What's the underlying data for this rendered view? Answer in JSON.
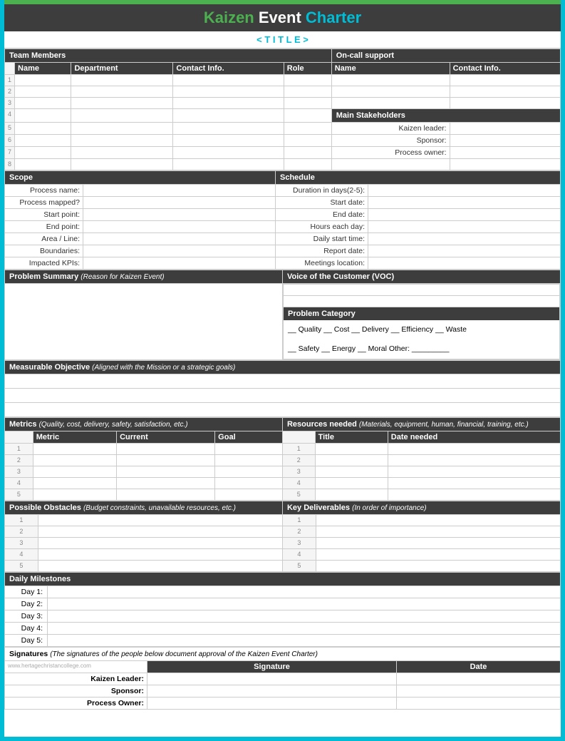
{
  "header": {
    "kaizen": "Kaizen",
    "event": " Event ",
    "charter": "Charter",
    "subtitle": "< T I T L E >",
    "website": "www.hertagechristancollege.com"
  },
  "team_members": {
    "label": "Team Members",
    "columns": [
      "Name",
      "Department",
      "Contact Info.",
      "Role"
    ],
    "rows": [
      "1",
      "2",
      "3",
      "4",
      "5",
      "6",
      "7",
      "8"
    ]
  },
  "on_call_support": {
    "label": "On-call support",
    "columns": [
      "Name",
      "Contact Info."
    ],
    "rows": [
      "",
      "",
      "",
      ""
    ]
  },
  "main_stakeholders": {
    "label": "Main Stakeholders",
    "rows": [
      "Kaizen leader:",
      "Sponsor:",
      "Process owner:"
    ]
  },
  "scope": {
    "label": "Scope",
    "rows": [
      "Process name:",
      "Process mapped?",
      "Start point:",
      "End point:",
      "Area / Line:",
      "Boundaries:",
      "Impacted KPIs:"
    ]
  },
  "schedule": {
    "label": "Schedule",
    "rows": [
      "Duration in days(2-5):",
      "Start date:",
      "End date:",
      "Hours each day:",
      "Daily start time:",
      "Report date:",
      "Meetings location:"
    ]
  },
  "problem_summary": {
    "label": "Problem Summary",
    "note": "(Reason for Kaizen Event)"
  },
  "voc": {
    "label": "Voice of the Customer (VOC)"
  },
  "problem_category": {
    "label": "Problem Category",
    "row1": "__ Quality   __ Cost   __ Delivery   __ Efficiency   __ Waste",
    "row2": "__ Safety   __ Energy   __ Moral   Other: _________"
  },
  "measurable_objective": {
    "label": "Measurable Objective",
    "note": "(Aligned with the Mission or a strategic goals)"
  },
  "metrics": {
    "label": "Metrics",
    "note": "(Quality, cost, delivery, safety, satisfaction, etc.)",
    "columns": [
      "Metric",
      "Current",
      "Goal"
    ],
    "rows": [
      "1",
      "2",
      "3",
      "4",
      "5"
    ]
  },
  "resources": {
    "label": "Resources needed",
    "note": "(Materials, equipment, human, financial, training, etc.)",
    "columns": [
      "Title",
      "Date needed"
    ],
    "rows": [
      "1",
      "2",
      "3",
      "4",
      "5"
    ]
  },
  "obstacles": {
    "label": "Possible Obstacles",
    "note": "(Budget constraints, unavailable resources, etc.)",
    "rows": [
      "1",
      "2",
      "3",
      "4",
      "5"
    ]
  },
  "deliverables": {
    "label": "Key Deliverables",
    "note": "(In order of importance)",
    "rows": [
      "1",
      "2",
      "3",
      "4",
      "5"
    ]
  },
  "daily_milestones": {
    "label": "Daily Milestones",
    "rows": [
      "Day 1:",
      "Day 2:",
      "Day 3:",
      "Day 4:",
      "Day 5:"
    ]
  },
  "signatures": {
    "label": "Signatures",
    "note": "(The signatures of the people below document approval of the Kaizen Event Charter)",
    "columns": [
      "Signature",
      "Date"
    ],
    "rows": [
      "Kaizen Leader:",
      "Sponsor:",
      "Process Owner:"
    ]
  }
}
